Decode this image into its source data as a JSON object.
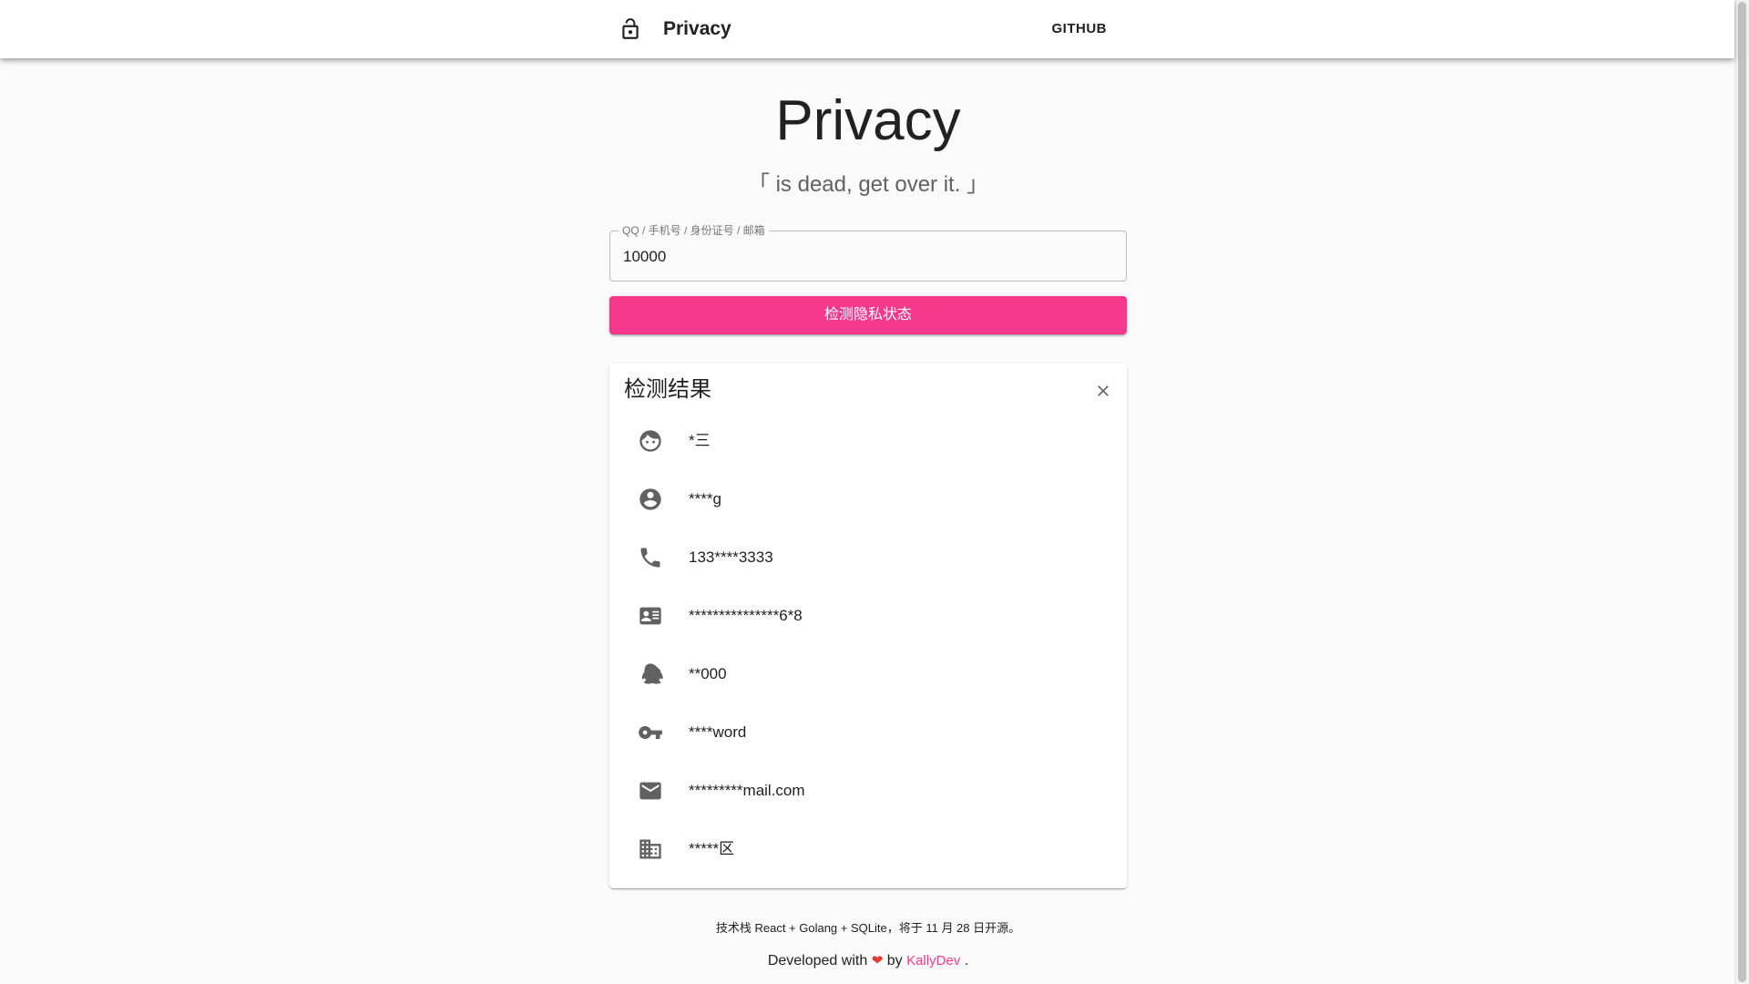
{
  "appbar": {
    "title": "Privacy",
    "github_label": "GITHUB"
  },
  "hero": {
    "title": "Privacy",
    "subtitle": "「 is dead, get over it. 」"
  },
  "search": {
    "label": "QQ / 手机号 / 身份证号 / 邮箱",
    "value": "10000"
  },
  "check_button": {
    "label": "检测隐私状态"
  },
  "results": {
    "title": "检测结果",
    "items": [
      {
        "icon": "face-icon",
        "text": "*三"
      },
      {
        "icon": "account-circle-icon",
        "text": "****g"
      },
      {
        "icon": "phone-icon",
        "text": "133****3333"
      },
      {
        "icon": "id-card-icon",
        "text": "***************6*8"
      },
      {
        "icon": "qq-penguin-icon",
        "text": "**000"
      },
      {
        "icon": "key-icon",
        "text": "****word"
      },
      {
        "icon": "email-icon",
        "text": "*********mail.com"
      },
      {
        "icon": "building-icon",
        "text": "*****区"
      }
    ]
  },
  "footer": {
    "note": "技术栈 React + Golang + SQLite，将于 11 月 28 日开源。",
    "dev_prefix": "Developed with",
    "heart": "❤",
    "by": "by",
    "author": "KallyDev",
    "dot": "."
  },
  "colors": {
    "accent": "#f5388c",
    "background": "#fafafa",
    "heart": "#e53935"
  }
}
